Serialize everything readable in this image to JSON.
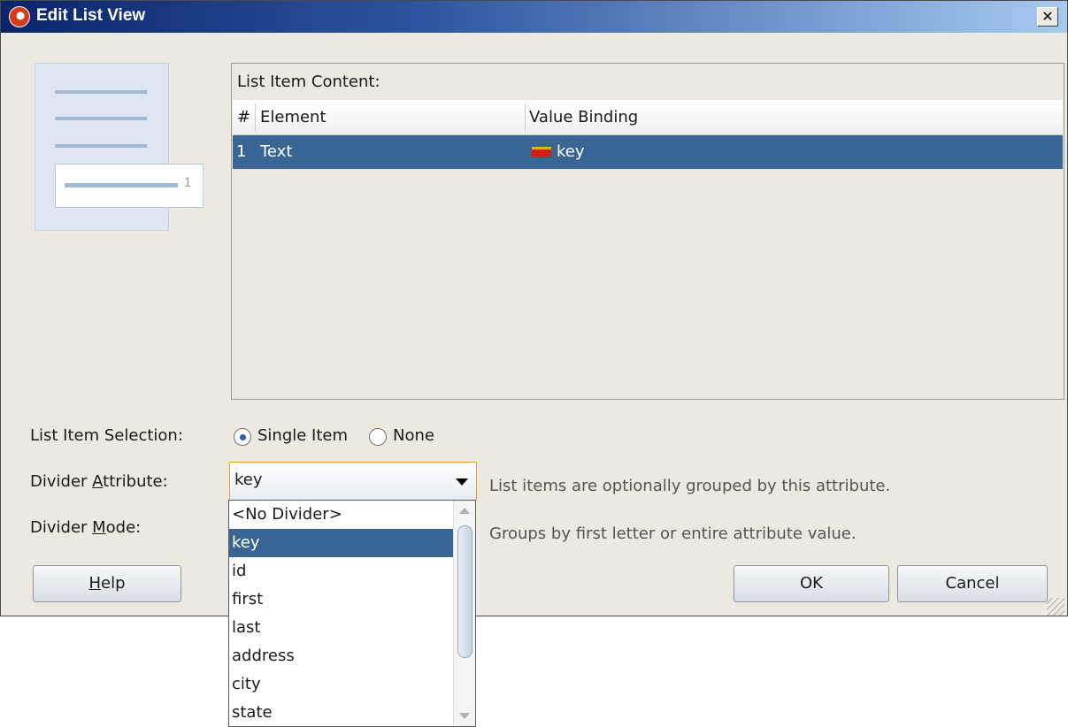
{
  "window": {
    "title": "Edit List View",
    "close_glyph": "✕"
  },
  "preview": {
    "item_number": "1"
  },
  "list_item_content": {
    "label": "List Item Content:",
    "columns": [
      "#",
      "Element",
      "Value Binding"
    ],
    "rows": [
      {
        "num": "1",
        "element": "Text",
        "binding": "key",
        "binding_icon": "binding-icon"
      }
    ]
  },
  "selection": {
    "label": "List Item Selection:",
    "options": [
      {
        "label": "Single Item",
        "selected": true
      },
      {
        "label": "None",
        "selected": false
      }
    ]
  },
  "divider_attribute": {
    "label_pre": "Divider ",
    "label_mnemonic": "A",
    "label_post": "ttribute:",
    "value": "key",
    "hint": "List items are optionally grouped by this attribute."
  },
  "divider_mode": {
    "label_pre": "Divider ",
    "label_mnemonic": "M",
    "label_post": "ode:",
    "hint": "Groups by first letter or entire attribute value."
  },
  "dropdown": {
    "options": [
      "<No Divider>",
      "key",
      "id",
      "first",
      "last",
      "address",
      "city",
      "state"
    ],
    "selected": "key"
  },
  "buttons": {
    "help_mnemonic": "H",
    "help_rest": "elp",
    "ok": "OK",
    "cancel": "Cancel"
  },
  "colors": {
    "selection": "#386593",
    "titlebar_start": "#0a246a",
    "titlebar_end": "#a6caf0",
    "combo_focus": "#e8a030"
  }
}
